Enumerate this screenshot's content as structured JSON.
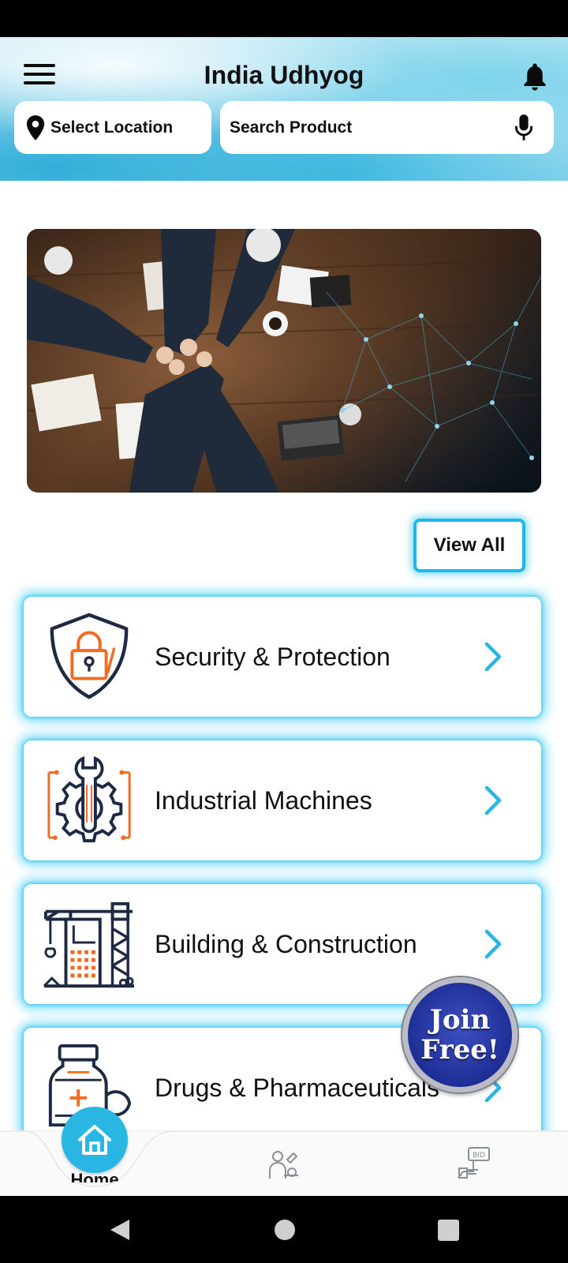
{
  "header": {
    "title": "India Udhyog",
    "location_label": "Select Location",
    "search_placeholder": "Search Product"
  },
  "banner": {
    "alt": ""
  },
  "view_all_label": "View All",
  "categories": [
    {
      "label": "Security & Protection",
      "icon": "security-shield-lock-icon"
    },
    {
      "label": "Industrial Machines",
      "icon": "gear-wrench-icon"
    },
    {
      "label": "Building & Construction",
      "icon": "building-crane-icon"
    },
    {
      "label": "Drugs & Pharmaceuticals",
      "icon": "medicine-bottle-icon"
    }
  ],
  "join_free": {
    "line1": "Join",
    "line2": "Free!"
  },
  "bottom_nav": {
    "home_label": "Home",
    "items": [
      "home-icon",
      "expert-icon",
      "bid-icon"
    ]
  },
  "colors": {
    "accent": "#29b6e3",
    "glow": "#2dc8f5",
    "icon_navy": "#1e2a44",
    "icon_orange": "#f26b21",
    "join_blue": "#1f2e96"
  }
}
